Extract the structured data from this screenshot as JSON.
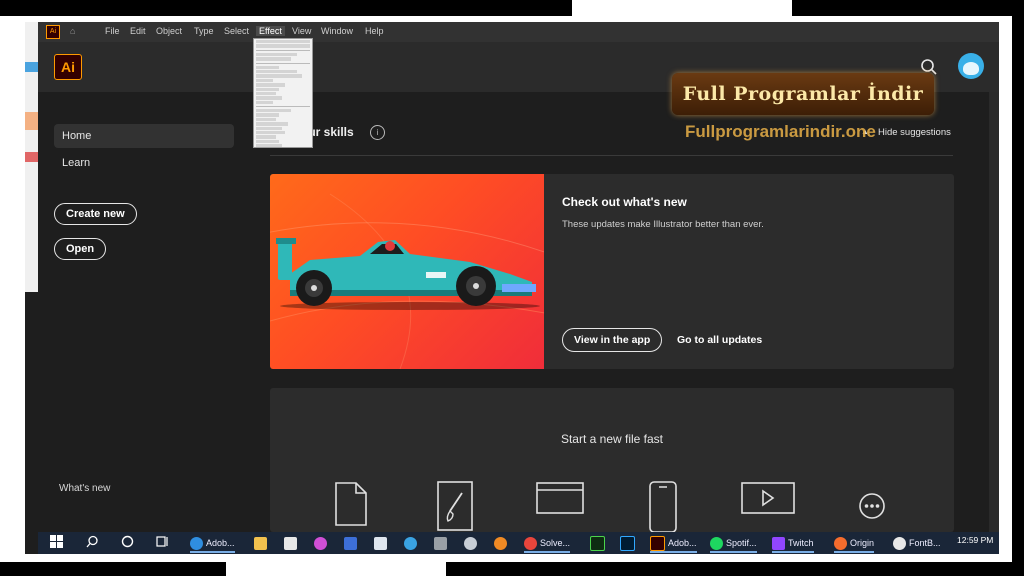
{
  "menu": {
    "items": [
      "File",
      "Edit",
      "Object",
      "Type",
      "Select",
      "Effect",
      "View",
      "Window",
      "Help"
    ],
    "active": "Effect"
  },
  "app": {
    "logo": "Ai"
  },
  "sidebar": {
    "items": [
      {
        "label": "Home"
      },
      {
        "label": "Learn"
      }
    ],
    "create_new": "Create new",
    "open": "Open",
    "whats_new": "What's new"
  },
  "main": {
    "skills_title": "our skills",
    "hide_suggestions": "Hide suggestions",
    "update_card": {
      "title": "Check out what's new",
      "description": "These updates make Illustrator better than ever.",
      "view_button": "View in the app",
      "all_updates": "Go to all updates"
    },
    "start_title": "Start a new file fast"
  },
  "watermark": {
    "badge": "Full Programlar İndir",
    "url": "Fullprogramlarindir.one"
  },
  "taskbar": {
    "items": [
      {
        "name": "edge",
        "label": "Adob..."
      },
      {
        "name": "chrome",
        "label": "Solve..."
      },
      {
        "name": "illustrator",
        "label": "Adob..."
      },
      {
        "name": "spotify",
        "label": "Spotif..."
      },
      {
        "name": "twitch",
        "label": "Twitch"
      },
      {
        "name": "origin",
        "label": "Origin"
      },
      {
        "name": "fontbase",
        "label": "FontB..."
      }
    ],
    "clock": "12:59 PM"
  },
  "colors": {
    "accent_orange": "#ff9a00",
    "avatar_blue": "#39b0e8",
    "banner_gradient_start": "#ff6a1a",
    "banner_gradient_end": "#f02d3a",
    "car_teal": "#2fb8b8"
  }
}
